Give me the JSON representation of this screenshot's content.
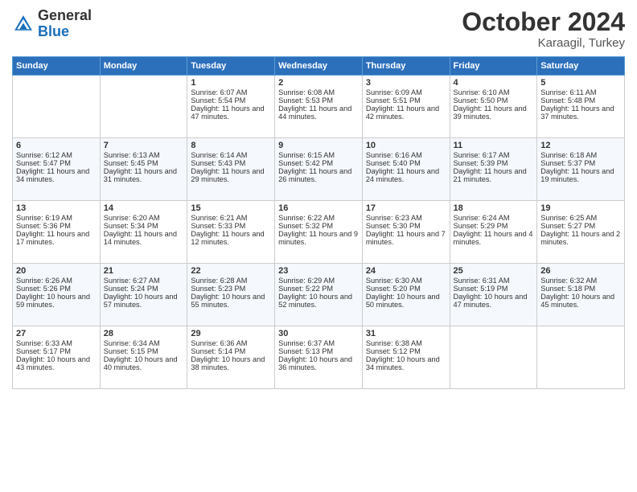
{
  "logo": {
    "general": "General",
    "blue": "Blue"
  },
  "header": {
    "month": "October 2024",
    "location": "Karaagil, Turkey"
  },
  "weekdays": [
    "Sunday",
    "Monday",
    "Tuesday",
    "Wednesday",
    "Thursday",
    "Friday",
    "Saturday"
  ],
  "weeks": [
    [
      {
        "day": "",
        "sunrise": "",
        "sunset": "",
        "daylight": ""
      },
      {
        "day": "",
        "sunrise": "",
        "sunset": "",
        "daylight": ""
      },
      {
        "day": "1",
        "sunrise": "Sunrise: 6:07 AM",
        "sunset": "Sunset: 5:54 PM",
        "daylight": "Daylight: 11 hours and 47 minutes."
      },
      {
        "day": "2",
        "sunrise": "Sunrise: 6:08 AM",
        "sunset": "Sunset: 5:53 PM",
        "daylight": "Daylight: 11 hours and 44 minutes."
      },
      {
        "day": "3",
        "sunrise": "Sunrise: 6:09 AM",
        "sunset": "Sunset: 5:51 PM",
        "daylight": "Daylight: 11 hours and 42 minutes."
      },
      {
        "day": "4",
        "sunrise": "Sunrise: 6:10 AM",
        "sunset": "Sunset: 5:50 PM",
        "daylight": "Daylight: 11 hours and 39 minutes."
      },
      {
        "day": "5",
        "sunrise": "Sunrise: 6:11 AM",
        "sunset": "Sunset: 5:48 PM",
        "daylight": "Daylight: 11 hours and 37 minutes."
      }
    ],
    [
      {
        "day": "6",
        "sunrise": "Sunrise: 6:12 AM",
        "sunset": "Sunset: 5:47 PM",
        "daylight": "Daylight: 11 hours and 34 minutes."
      },
      {
        "day": "7",
        "sunrise": "Sunrise: 6:13 AM",
        "sunset": "Sunset: 5:45 PM",
        "daylight": "Daylight: 11 hours and 31 minutes."
      },
      {
        "day": "8",
        "sunrise": "Sunrise: 6:14 AM",
        "sunset": "Sunset: 5:43 PM",
        "daylight": "Daylight: 11 hours and 29 minutes."
      },
      {
        "day": "9",
        "sunrise": "Sunrise: 6:15 AM",
        "sunset": "Sunset: 5:42 PM",
        "daylight": "Daylight: 11 hours and 26 minutes."
      },
      {
        "day": "10",
        "sunrise": "Sunrise: 6:16 AM",
        "sunset": "Sunset: 5:40 PM",
        "daylight": "Daylight: 11 hours and 24 minutes."
      },
      {
        "day": "11",
        "sunrise": "Sunrise: 6:17 AM",
        "sunset": "Sunset: 5:39 PM",
        "daylight": "Daylight: 11 hours and 21 minutes."
      },
      {
        "day": "12",
        "sunrise": "Sunrise: 6:18 AM",
        "sunset": "Sunset: 5:37 PM",
        "daylight": "Daylight: 11 hours and 19 minutes."
      }
    ],
    [
      {
        "day": "13",
        "sunrise": "Sunrise: 6:19 AM",
        "sunset": "Sunset: 5:36 PM",
        "daylight": "Daylight: 11 hours and 17 minutes."
      },
      {
        "day": "14",
        "sunrise": "Sunrise: 6:20 AM",
        "sunset": "Sunset: 5:34 PM",
        "daylight": "Daylight: 11 hours and 14 minutes."
      },
      {
        "day": "15",
        "sunrise": "Sunrise: 6:21 AM",
        "sunset": "Sunset: 5:33 PM",
        "daylight": "Daylight: 11 hours and 12 minutes."
      },
      {
        "day": "16",
        "sunrise": "Sunrise: 6:22 AM",
        "sunset": "Sunset: 5:32 PM",
        "daylight": "Daylight: 11 hours and 9 minutes."
      },
      {
        "day": "17",
        "sunrise": "Sunrise: 6:23 AM",
        "sunset": "Sunset: 5:30 PM",
        "daylight": "Daylight: 11 hours and 7 minutes."
      },
      {
        "day": "18",
        "sunrise": "Sunrise: 6:24 AM",
        "sunset": "Sunset: 5:29 PM",
        "daylight": "Daylight: 11 hours and 4 minutes."
      },
      {
        "day": "19",
        "sunrise": "Sunrise: 6:25 AM",
        "sunset": "Sunset: 5:27 PM",
        "daylight": "Daylight: 11 hours and 2 minutes."
      }
    ],
    [
      {
        "day": "20",
        "sunrise": "Sunrise: 6:26 AM",
        "sunset": "Sunset: 5:26 PM",
        "daylight": "Daylight: 10 hours and 59 minutes."
      },
      {
        "day": "21",
        "sunrise": "Sunrise: 6:27 AM",
        "sunset": "Sunset: 5:24 PM",
        "daylight": "Daylight: 10 hours and 57 minutes."
      },
      {
        "day": "22",
        "sunrise": "Sunrise: 6:28 AM",
        "sunset": "Sunset: 5:23 PM",
        "daylight": "Daylight: 10 hours and 55 minutes."
      },
      {
        "day": "23",
        "sunrise": "Sunrise: 6:29 AM",
        "sunset": "Sunset: 5:22 PM",
        "daylight": "Daylight: 10 hours and 52 minutes."
      },
      {
        "day": "24",
        "sunrise": "Sunrise: 6:30 AM",
        "sunset": "Sunset: 5:20 PM",
        "daylight": "Daylight: 10 hours and 50 minutes."
      },
      {
        "day": "25",
        "sunrise": "Sunrise: 6:31 AM",
        "sunset": "Sunset: 5:19 PM",
        "daylight": "Daylight: 10 hours and 47 minutes."
      },
      {
        "day": "26",
        "sunrise": "Sunrise: 6:32 AM",
        "sunset": "Sunset: 5:18 PM",
        "daylight": "Daylight: 10 hours and 45 minutes."
      }
    ],
    [
      {
        "day": "27",
        "sunrise": "Sunrise: 6:33 AM",
        "sunset": "Sunset: 5:17 PM",
        "daylight": "Daylight: 10 hours and 43 minutes."
      },
      {
        "day": "28",
        "sunrise": "Sunrise: 6:34 AM",
        "sunset": "Sunset: 5:15 PM",
        "daylight": "Daylight: 10 hours and 40 minutes."
      },
      {
        "day": "29",
        "sunrise": "Sunrise: 6:36 AM",
        "sunset": "Sunset: 5:14 PM",
        "daylight": "Daylight: 10 hours and 38 minutes."
      },
      {
        "day": "30",
        "sunrise": "Sunrise: 6:37 AM",
        "sunset": "Sunset: 5:13 PM",
        "daylight": "Daylight: 10 hours and 36 minutes."
      },
      {
        "day": "31",
        "sunrise": "Sunrise: 6:38 AM",
        "sunset": "Sunset: 5:12 PM",
        "daylight": "Daylight: 10 hours and 34 minutes."
      },
      {
        "day": "",
        "sunrise": "",
        "sunset": "",
        "daylight": ""
      },
      {
        "day": "",
        "sunrise": "",
        "sunset": "",
        "daylight": ""
      }
    ]
  ]
}
